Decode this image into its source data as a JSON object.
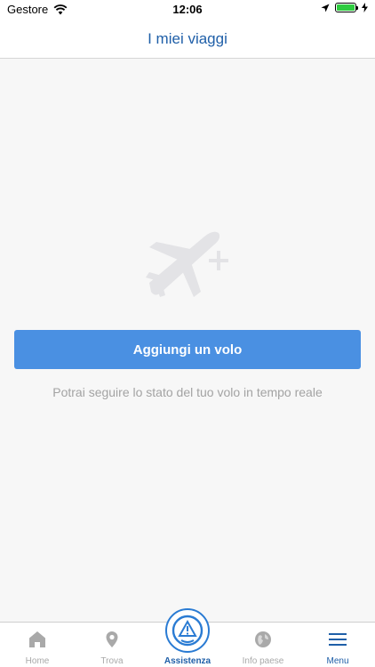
{
  "status_bar": {
    "carrier": "Gestore",
    "time": "12:06",
    "battery_color": "#2ecc40"
  },
  "nav": {
    "title": "I miei viaggi"
  },
  "main": {
    "illustration_icon": "plane-add-icon",
    "add_button_label": "Aggiungi un volo",
    "hint": "Potrai seguire lo stato del tuo volo in tempo reale"
  },
  "tabbar": {
    "items": [
      {
        "label": "Home",
        "icon": "home-icon"
      },
      {
        "label": "Trova",
        "icon": "location-pin-icon"
      },
      {
        "label": "Assistenza",
        "icon": "assistance-warning-icon"
      },
      {
        "label": "Info paese",
        "icon": "globe-icon"
      },
      {
        "label": "Menu",
        "icon": "menu-icon"
      }
    ],
    "active_color": "#1f5fa8",
    "inactive_color": "#a9a9a9"
  },
  "colors": {
    "accent": "#4a90e2",
    "title": "#1f5fa8",
    "background": "#f7f7f7"
  }
}
